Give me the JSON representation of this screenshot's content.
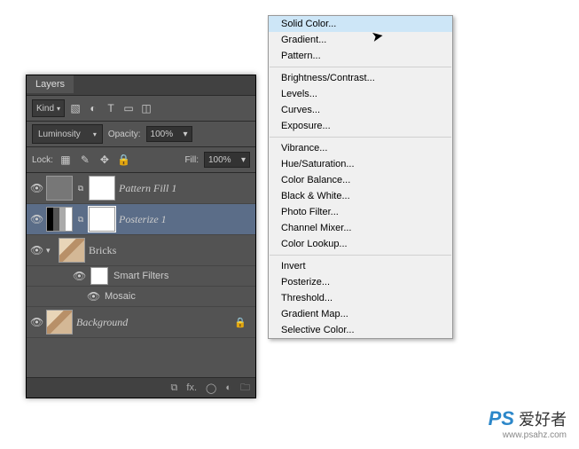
{
  "panel": {
    "tab": "Layers",
    "kind": "Kind",
    "blend_mode": "Luminosity",
    "opacity_label": "Opacity:",
    "opacity": "100%",
    "lock_label": "Lock:",
    "fill_label": "Fill:",
    "fill": "100%"
  },
  "layers": [
    {
      "name": "Pattern Fill 1"
    },
    {
      "name": "Posterize 1"
    },
    {
      "name": "Bricks"
    },
    {
      "sf": "Smart Filters"
    },
    {
      "mosaic": "Mosaic"
    },
    {
      "bg": "Background"
    }
  ],
  "menu": {
    "g1": [
      "Solid Color...",
      "Gradient...",
      "Pattern..."
    ],
    "g2": [
      "Brightness/Contrast...",
      "Levels...",
      "Curves...",
      "Exposure..."
    ],
    "g3": [
      "Vibrance...",
      "Hue/Saturation...",
      "Color Balance...",
      "Black & White...",
      "Photo Filter...",
      "Channel Mixer...",
      "Color Lookup..."
    ],
    "g4": [
      "Invert",
      "Posterize...",
      "Threshold...",
      "Gradient Map...",
      "Selective Color..."
    ]
  },
  "wm": {
    "brand": "PS",
    "text": " 爱好者",
    "url": "www.psahz.com"
  }
}
